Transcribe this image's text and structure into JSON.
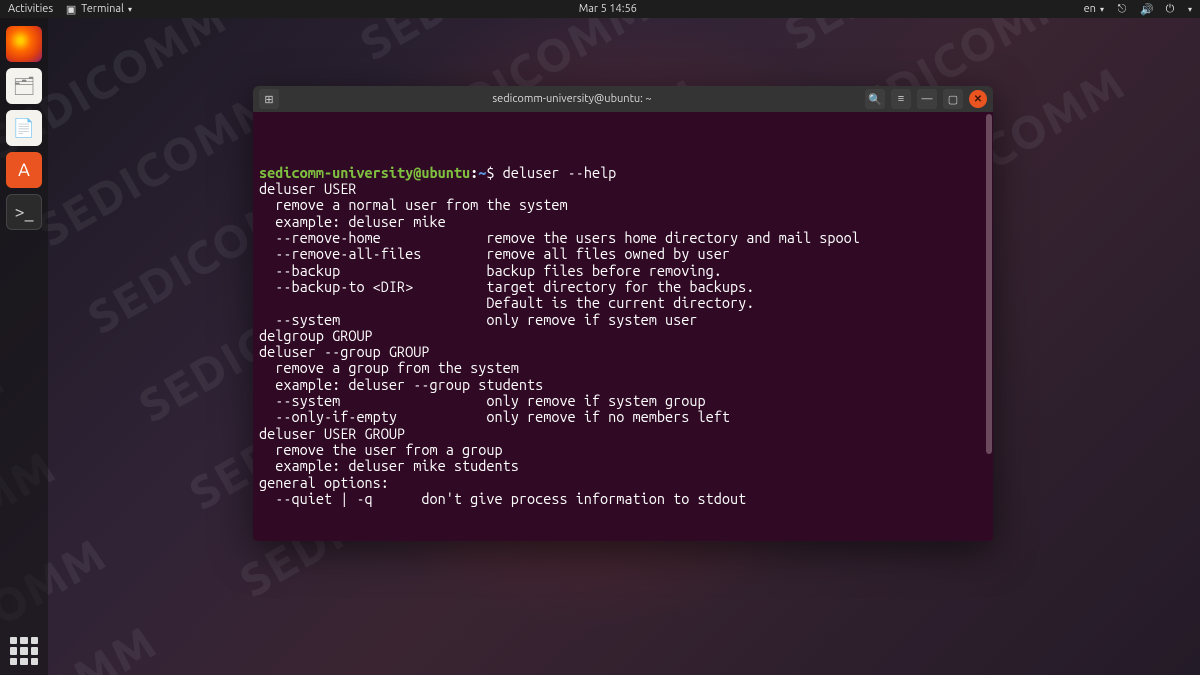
{
  "topbar": {
    "activities": "Activities",
    "terminal_menu": "Terminal",
    "datetime": "Mar 5  14:56",
    "lang": "en"
  },
  "dock": {
    "firefox": "Firefox",
    "files": "Files",
    "writer": "LibreOffice Writer",
    "store": "Ubuntu Software",
    "terminal": "Terminal",
    "apps": "Show Applications"
  },
  "terminal": {
    "title": "sedicomm-university@ubuntu: ~",
    "titlebar": {
      "new_tab": "New tab",
      "search": "Search",
      "menu": "Menu",
      "minimize": "Minimize",
      "maximize": "Maximize",
      "close": "Close"
    },
    "prompt": {
      "user": "sedicomm-university@ubuntu",
      "sep": ":",
      "path": "~",
      "dollar": "$ "
    },
    "command": "deluser --help",
    "output": [
      "deluser USER",
      "  remove a normal user from the system",
      "  example: deluser mike",
      "",
      "  --remove-home             remove the users home directory and mail spool",
      "  --remove-all-files        remove all files owned by user",
      "  --backup                  backup files before removing.",
      "  --backup-to <DIR>         target directory for the backups.",
      "                            Default is the current directory.",
      "  --system                  only remove if system user",
      "",
      "delgroup GROUP",
      "deluser --group GROUP",
      "  remove a group from the system",
      "  example: deluser --group students",
      "",
      "  --system                  only remove if system group",
      "  --only-if-empty           only remove if no members left",
      "",
      "deluser USER GROUP",
      "  remove the user from a group",
      "  example: deluser mike students",
      "",
      "general options:",
      "  --quiet | -q      don't give process information to stdout"
    ]
  }
}
